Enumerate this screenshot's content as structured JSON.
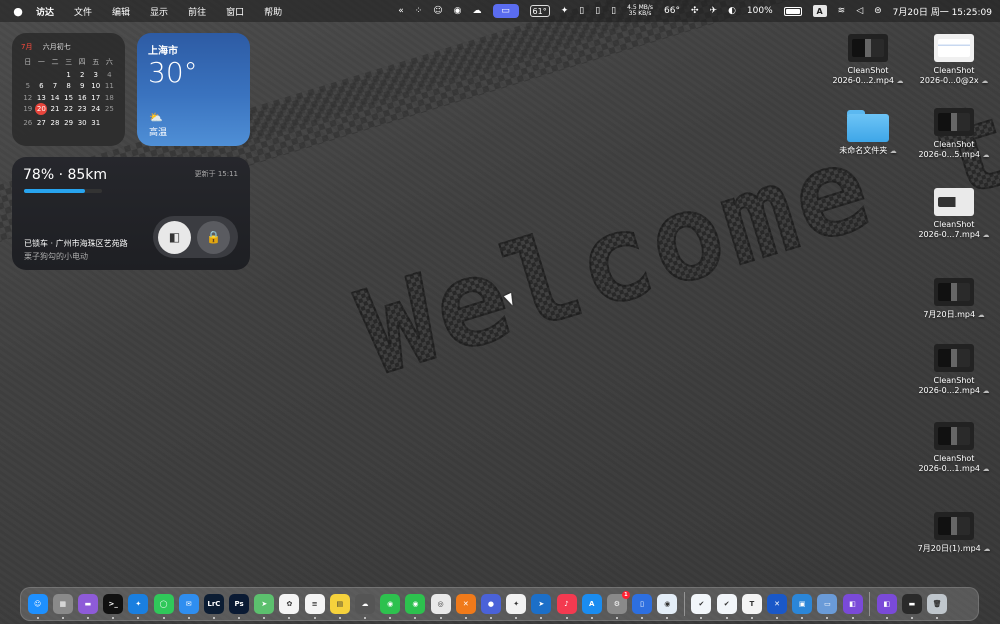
{
  "menubar": {
    "apple_icon": "apple-icon",
    "items": [
      "访达",
      "文件",
      "编辑",
      "显示",
      "前往",
      "窗口",
      "帮助"
    ],
    "tray": {
      "temp_badge": "61°",
      "net_up": "4.5 MB/s",
      "net_down": "35 KB/s",
      "cpu_temp": "66°",
      "battery": "100%",
      "input_method": "A",
      "datetime": "7月20日 周一 15:25:09"
    }
  },
  "calendar": {
    "month": "7月",
    "lunar": "六月初七",
    "weekdays": [
      "日",
      "一",
      "二",
      "三",
      "四",
      "五",
      "六"
    ],
    "today": "20",
    "days": [
      [
        "",
        "",
        "",
        "1",
        "2",
        "3",
        "4"
      ],
      [
        "5",
        "6",
        "7",
        "8",
        "9",
        "10",
        "11"
      ],
      [
        "12",
        "13",
        "14",
        "15",
        "16",
        "17",
        "18"
      ],
      [
        "19",
        "20",
        "21",
        "22",
        "23",
        "24",
        "25"
      ],
      [
        "26",
        "27",
        "28",
        "29",
        "30",
        "31",
        ""
      ]
    ]
  },
  "weather": {
    "city": "上海市",
    "temperature": "30°",
    "condition": "高温"
  },
  "ev": {
    "status": "78% · 85km",
    "battery_fraction": 0.78,
    "updated": "更新于 15:11",
    "location": "已锁车 · 广州市海珠区艺苑路",
    "vehicle_name": "栗子狗勾的小电动"
  },
  "wallpaper": {
    "text": "Welcome t"
  },
  "desktop_icons": [
    {
      "line1": "CleanShot",
      "line2": "2026-0...2.mp4",
      "thumb": "dark"
    },
    {
      "line1": "CleanShot",
      "line2": "2026-0...0@2x",
      "thumb": "light"
    },
    {
      "line1": "",
      "line2": "未命名文件夹",
      "thumb": "folder"
    },
    {
      "line1": "CleanShot",
      "line2": "2026-0...5.mp4",
      "thumb": "dark"
    },
    {
      "line1": "CleanShot",
      "line2": "2026-0...7.mp4",
      "thumb": "white"
    },
    {
      "line1": "",
      "line2": "7月20日.mp4",
      "thumb": "dark"
    },
    {
      "line1": "CleanShot",
      "line2": "2026-0...2.mp4",
      "thumb": "dark"
    },
    {
      "line1": "CleanShot",
      "line2": "2026-0...1.mp4",
      "thumb": "dark"
    },
    {
      "line1": "",
      "line2": "7月20日(1).mp4",
      "thumb": "dark"
    }
  ],
  "dock": {
    "apps": [
      {
        "name": "finder",
        "color": "#1e90ff",
        "glyph": "☺"
      },
      {
        "name": "launchpad",
        "color": "#8a8a8a",
        "glyph": "▦"
      },
      {
        "name": "app-purple",
        "color": "#8e5bd8",
        "glyph": "▬"
      },
      {
        "name": "terminal",
        "color": "#111111",
        "glyph": ">_"
      },
      {
        "name": "safari",
        "color": "#1a7fe0",
        "glyph": "✦"
      },
      {
        "name": "messages",
        "color": "#30c85a",
        "glyph": "◯"
      },
      {
        "name": "mail",
        "color": "#2f8ef0",
        "glyph": "✉"
      },
      {
        "name": "lightroom",
        "color": "#0c1d33",
        "glyph": "LrC"
      },
      {
        "name": "photoshop",
        "color": "#0a1a33",
        "glyph": "Ps"
      },
      {
        "name": "maps",
        "color": "#5cc06e",
        "glyph": "➤"
      },
      {
        "name": "photos",
        "color": "#f4f4f4",
        "glyph": "✿"
      },
      {
        "name": "reminders",
        "color": "#f4f4f4",
        "glyph": "≡"
      },
      {
        "name": "notes",
        "color": "#f6d23c",
        "glyph": "▤"
      },
      {
        "name": "cloud-app",
        "color": "#555555",
        "glyph": "☁"
      },
      {
        "name": "wechat",
        "color": "#2dc14e",
        "glyph": "◉"
      },
      {
        "name": "wechat-work",
        "color": "#2dc14e",
        "glyph": "◉"
      },
      {
        "name": "chrome",
        "color": "#e9e9e9",
        "glyph": "◎"
      },
      {
        "name": "app-orange",
        "color": "#f07a1a",
        "glyph": "✕"
      },
      {
        "name": "app-blue-circle",
        "color": "#4a62d8",
        "glyph": "●"
      },
      {
        "name": "app-star",
        "color": "#f2f2f2",
        "glyph": "✦"
      },
      {
        "name": "telegram",
        "color": "#1c6fc8",
        "glyph": "➤"
      },
      {
        "name": "music",
        "color": "#f33a50",
        "glyph": "♪"
      },
      {
        "name": "app-store",
        "color": "#1a8cf0",
        "glyph": "A"
      },
      {
        "name": "system-settings",
        "color": "#8a8a8a",
        "glyph": "⚙"
      },
      {
        "name": "app-device",
        "color": "#2d6fe0",
        "glyph": "▯"
      },
      {
        "name": "app-eye",
        "color": "#e4eef8",
        "glyph": "◉"
      },
      {
        "name": "sep-1",
        "color": "",
        "glyph": ""
      },
      {
        "name": "app-bird-1",
        "color": "#f2f6fa",
        "glyph": "✔"
      },
      {
        "name": "app-bird-2",
        "color": "#f2f6fa",
        "glyph": "✔"
      },
      {
        "name": "typora",
        "color": "#f4f4f4",
        "glyph": "T"
      },
      {
        "name": "app-x-blue",
        "color": "#1a58c8",
        "glyph": "✕"
      },
      {
        "name": "app-box",
        "color": "#2b86d8",
        "glyph": "▣"
      },
      {
        "name": "app-window",
        "color": "#6a9bd8",
        "glyph": "▭"
      },
      {
        "name": "app-purple-2",
        "color": "#7a4ad8",
        "glyph": "◧"
      },
      {
        "name": "sep-2",
        "color": "",
        "glyph": ""
      },
      {
        "name": "app-purple-3",
        "color": "#7a4ad8",
        "glyph": "◧"
      },
      {
        "name": "app-screen",
        "color": "#2a2a2a",
        "glyph": "▬"
      },
      {
        "name": "trash",
        "color": "#bfc6cc",
        "glyph": "🗑"
      }
    ],
    "settings_badge": "1"
  }
}
